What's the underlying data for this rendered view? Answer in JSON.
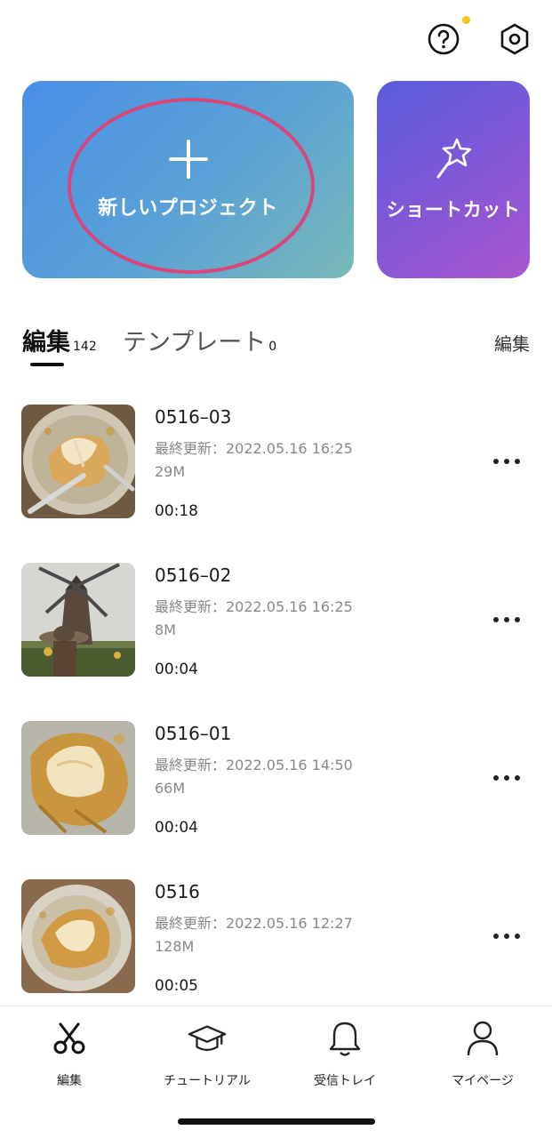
{
  "header": {
    "help_icon": "question-circle-icon",
    "settings_icon": "hexagon-gear-icon",
    "notify_color": "#f5c518"
  },
  "actions": {
    "new_project": {
      "label": "新しいプロジェクト",
      "icon": "plus-icon"
    },
    "shortcut": {
      "label": "ショートカット",
      "icon": "magic-wand-icon"
    },
    "highlight_color": "#d9467a"
  },
  "tabs": {
    "edit": {
      "label": "編集",
      "count": "142"
    },
    "template": {
      "label": "テンプレート",
      "count": "0"
    },
    "edit_link": "編集"
  },
  "projects": [
    {
      "title": "0516–03",
      "updated": "最終更新：2022.05.16 16:25",
      "size": "29M",
      "duration": "00:18",
      "thumb": "waffle-fork-photo"
    },
    {
      "title": "0516–02",
      "updated": "最終更新：2022.05.16 16:25",
      "size": "8M",
      "duration": "00:04",
      "thumb": "windmill-photo"
    },
    {
      "title": "0516–01",
      "updated": "最終更新：2022.05.16 14:50",
      "size": "66M",
      "duration": "00:04",
      "thumb": "waffle-closeup-photo"
    },
    {
      "title": "0516",
      "updated": "最終更新：2022.05.16 12:27",
      "size": "128M",
      "duration": "00:05",
      "thumb": "waffle-plate-photo"
    }
  ],
  "nav": [
    {
      "label": "編集",
      "icon": "scissors-icon"
    },
    {
      "label": "チュートリアル",
      "icon": "graduation-cap-icon"
    },
    {
      "label": "受信トレイ",
      "icon": "bell-icon"
    },
    {
      "label": "マイページ",
      "icon": "person-icon"
    }
  ]
}
